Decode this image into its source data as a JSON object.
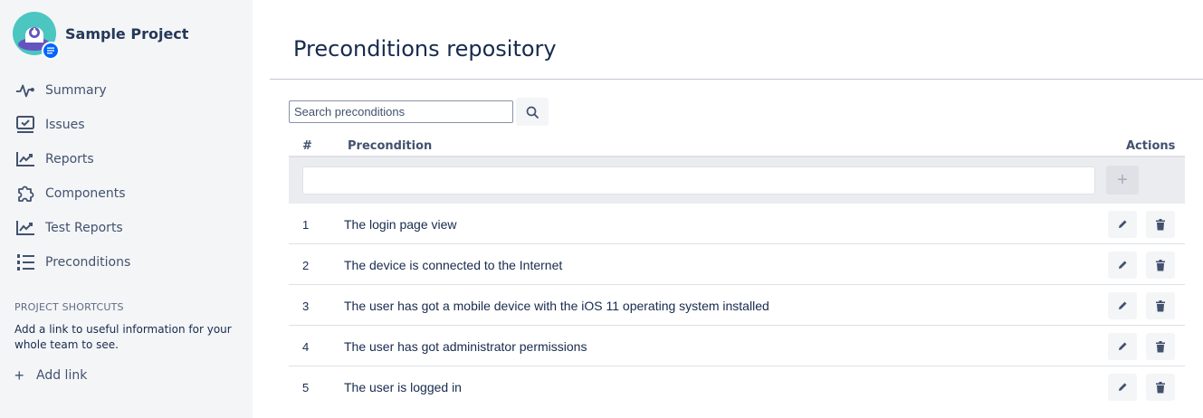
{
  "sidebar": {
    "project_name": "Sample Project",
    "nav": [
      {
        "label": "Summary",
        "icon": "pulse-icon"
      },
      {
        "label": "Issues",
        "icon": "issues-icon"
      },
      {
        "label": "Reports",
        "icon": "chart-line-icon"
      },
      {
        "label": "Components",
        "icon": "puzzle-icon"
      },
      {
        "label": "Test Reports",
        "icon": "chart-line-icon"
      },
      {
        "label": "Preconditions",
        "icon": "numbered-list-icon"
      }
    ],
    "shortcuts_title": "PROJECT SHORTCUTS",
    "shortcuts_desc": "Add a link to useful information for your whole team to see.",
    "add_link": "Add link"
  },
  "main": {
    "title": "Preconditions repository",
    "search_placeholder": "Search preconditions",
    "table": {
      "headers": {
        "num": "#",
        "precondition": "Precondition",
        "actions": "Actions"
      },
      "add_button": "+",
      "rows": [
        {
          "num": "1",
          "text": "The login page view"
        },
        {
          "num": "2",
          "text": "The device is connected to the Internet"
        },
        {
          "num": "3",
          "text": "The user has got a mobile device with the iOS 11 operating system installed"
        },
        {
          "num": "4",
          "text": "The user has got administrator permissions"
        },
        {
          "num": "5",
          "text": "The user is logged in"
        }
      ]
    }
  },
  "colors": {
    "sidebar_bg": "#f4f5f7",
    "accent": "#0065ff",
    "avatar_teal": "#4bc6c0",
    "avatar_purple": "#6554c0",
    "text": "#172b4d"
  }
}
